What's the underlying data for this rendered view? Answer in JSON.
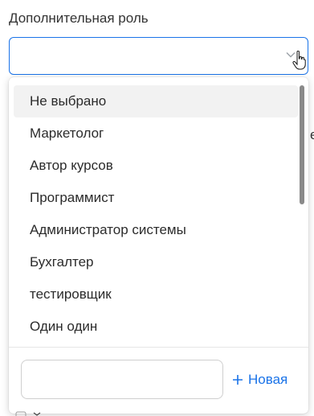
{
  "field": {
    "label": "Дополнительная роль",
    "value": ""
  },
  "dropdown": {
    "options": [
      {
        "label": "Не выбрано",
        "selected": true
      },
      {
        "label": "Маркетолог",
        "selected": false
      },
      {
        "label": "Автор курсов",
        "selected": false
      },
      {
        "label": "Программист",
        "selected": false
      },
      {
        "label": "Администратор системы",
        "selected": false
      },
      {
        "label": "Бухгалтер",
        "selected": false
      },
      {
        "label": "тестировщик",
        "selected": false
      },
      {
        "label": "Один один",
        "selected": false
      }
    ],
    "new_input_value": "",
    "new_button_label": "Новая"
  },
  "behind": {
    "partial_text": "е"
  },
  "colors": {
    "accent": "#1a73e8",
    "selected_bg": "#f2f2f2",
    "scrollbar": "#8a8a8a"
  },
  "icons": {
    "chevron": "chevron-down-icon",
    "cursor": "hand-pointer-icon",
    "plus": "plus-icon"
  }
}
